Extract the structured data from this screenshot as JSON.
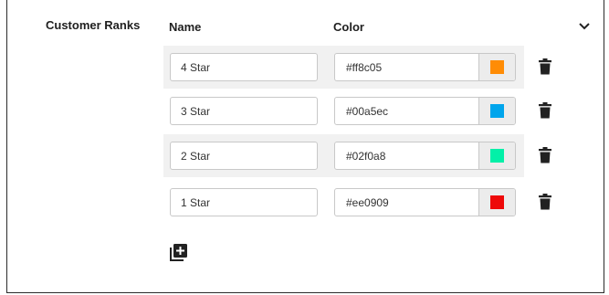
{
  "section": {
    "title": "Customer Ranks",
    "expand_icon": "chevron-down-icon"
  },
  "columns": {
    "name": "Name",
    "color": "Color"
  },
  "ranks": [
    {
      "name": "4 Star",
      "color": "#ff8c05"
    },
    {
      "name": "3 Star",
      "color": "#00a5ec"
    },
    {
      "name": "2 Star",
      "color": "#02f0a8"
    },
    {
      "name": "1 Star",
      "color": "#ee0909"
    }
  ],
  "icons": {
    "delete": "trash-icon",
    "add": "add-library-icon"
  }
}
